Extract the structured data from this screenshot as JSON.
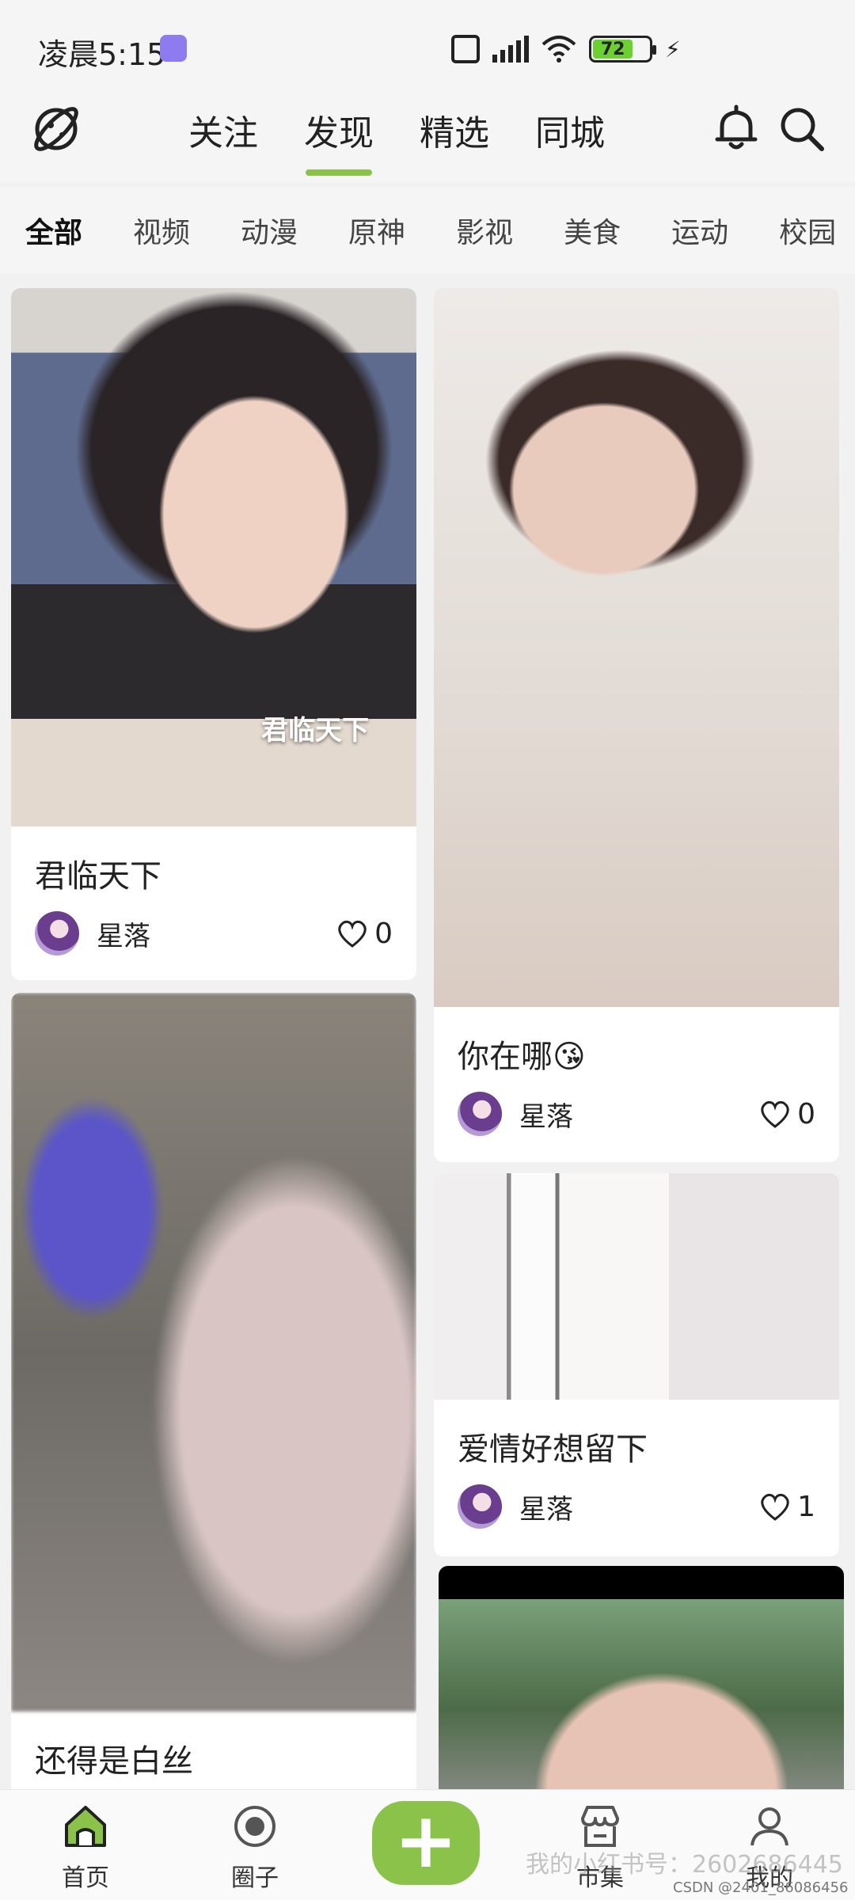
{
  "status_bar": {
    "time": "凌晨5:15",
    "battery": "72"
  },
  "top_nav": {
    "tabs": [
      {
        "label": "关注"
      },
      {
        "label": "发现"
      },
      {
        "label": "精选"
      },
      {
        "label": "同城"
      }
    ],
    "active_tab": "发现"
  },
  "categories": [
    {
      "label": "全部"
    },
    {
      "label": "视频"
    },
    {
      "label": "动漫"
    },
    {
      "label": "原神"
    },
    {
      "label": "影视"
    },
    {
      "label": "美食"
    },
    {
      "label": "运动"
    },
    {
      "label": "校园"
    }
  ],
  "feed": [
    {
      "title": "君临天下",
      "overlay_caption": "君临天下",
      "author": "星落",
      "likes": "0"
    },
    {
      "title": "你在哪😘",
      "author": "星落",
      "likes": "0"
    },
    {
      "title": "还得是白丝"
    },
    {
      "title": "爱情好想留下",
      "author": "星落",
      "likes": "1"
    },
    {}
  ],
  "bottom_nav": {
    "home": "首页",
    "circle": "圈子",
    "add": "+",
    "market": "市集",
    "me": "我的"
  },
  "watermark": "我的小红书号：2602686445",
  "credit": "CSDN @2401_86086456",
  "colors": {
    "accent": "#8bc34a",
    "battery": "#6ccf32",
    "background": "#f1f1f1"
  }
}
